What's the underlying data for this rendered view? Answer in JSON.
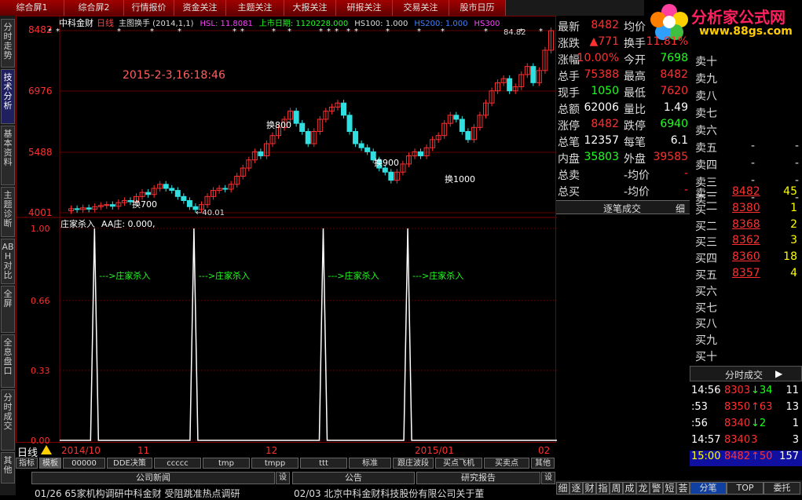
{
  "top_tabs": [
    "综合屏1",
    "综合屏2",
    "行情报价",
    "资金关注",
    "主题关注",
    "大报关注",
    "研报关注",
    "交易关注",
    "股市日历"
  ],
  "logo": {
    "text": "分析家公式网",
    "url": "www.88gs.com"
  },
  "side_tabs": [
    "分时走势",
    "技术分析",
    "基本资料",
    "主题诊断",
    "ABH对比",
    "全屏",
    "全息盘口",
    "分时成交",
    "其他"
  ],
  "chart": {
    "title": "中科金财",
    "period": "日线",
    "indicator_name": "主图换手 (2014,1,1)",
    "header_items": [
      "HSL: 11.8081",
      "上市日期: 1120228.000",
      "HS100: 1.000",
      "HS200: 1.000",
      "HS300"
    ],
    "datetime": "2015-2-3,16:18:46",
    "top_price": "84.82",
    "price_axis": [
      "8482",
      "6976",
      "5488",
      "4001"
    ],
    "low_label": "40.01",
    "annotations": [
      "换700",
      "换800",
      "换900",
      "换1000"
    ],
    "month_axis": [
      "2014/10",
      "11",
      "12",
      "2015/01",
      "02"
    ],
    "period_label": "日线"
  },
  "chart_data": {
    "type": "line",
    "title": "庄家杀入",
    "legend": "AA庄: 0.000,",
    "ylim": [
      0,
      1
    ],
    "y_ticks": [
      "1.00",
      "0.66",
      "0.33",
      "0.00"
    ],
    "spikes_label": "--->庄家杀入",
    "spike_positions_x_fraction": [
      0.07,
      0.27,
      0.53,
      0.7
    ],
    "series": [
      {
        "values": [
          0,
          1,
          0,
          1,
          0,
          1,
          0,
          1,
          0
        ]
      }
    ]
  },
  "indicator_tabs": [
    "指标",
    "模板",
    "00000",
    "DDE决策",
    "ccccc",
    "tmp",
    "tmpp",
    "ttt",
    "标准",
    "跟庄波段",
    "买点飞机",
    "买卖点",
    "其他"
  ],
  "news": {
    "company": "公司新闻",
    "notice": "公告",
    "report": "研究报告",
    "set": "设",
    "n1": "01/26 65家机构调研中科金财 受阻跳准热点调研",
    "n2": "02/03 北京中科金财科技股份有限公司关于董"
  },
  "quote": [
    [
      "最新",
      "8482",
      "均价",
      ""
    ],
    [
      "涨跌",
      "▲771",
      "换手",
      "11.81%"
    ],
    [
      "涨幅",
      "10.00%",
      "今开",
      "7698"
    ],
    [
      "总手",
      "75388",
      "最高",
      "8482"
    ],
    [
      "现手",
      "1050",
      "最低",
      "7620"
    ],
    [
      "总额",
      "62006",
      "量比",
      "1.49"
    ],
    [
      "涨停",
      "8482",
      "跌停",
      "6940"
    ],
    [
      "总笔",
      "12357",
      "每笔",
      "6.1"
    ],
    [
      "内盘",
      "35803",
      "外盘",
      "39585"
    ],
    [
      "总卖",
      "",
      "-均价",
      "-"
    ],
    [
      "总买",
      "",
      "-均价",
      "-"
    ]
  ],
  "zhubi": {
    "label": "逐笔成交",
    "btn": "细"
  },
  "sell": [
    [
      "卖十",
      "",
      ""
    ],
    [
      "卖九",
      "",
      ""
    ],
    [
      "卖八",
      "",
      ""
    ],
    [
      "卖七",
      "",
      ""
    ],
    [
      "卖六",
      "",
      ""
    ],
    [
      "卖五",
      "-",
      "-"
    ],
    [
      "卖四",
      "-",
      "-"
    ],
    [
      "卖三",
      "-",
      "-"
    ],
    [
      "卖二",
      "-",
      "-"
    ]
  ],
  "buy": [
    [
      "卖一",
      "8482",
      "45"
    ],
    [
      "买一",
      "8380",
      "1"
    ],
    [
      "买二",
      "8368",
      "2"
    ],
    [
      "买三",
      "8362",
      "3"
    ],
    [
      "买四",
      "8360",
      "18"
    ],
    [
      "买五",
      "8357",
      "4"
    ],
    [
      "买六",
      "",
      ""
    ],
    [
      "买七",
      "",
      ""
    ],
    [
      "买八",
      "",
      ""
    ],
    [
      "买九",
      "",
      ""
    ],
    [
      "买十",
      "",
      ""
    ]
  ],
  "ticks_title": "分时成交",
  "ticks": [
    [
      "14:56",
      "8303",
      "↓34",
      "11"
    ],
    [
      ":53",
      "8350",
      "↑63",
      "13"
    ],
    [
      ":56",
      "8340",
      "↓2",
      "1"
    ],
    [
      "14:57",
      "8340",
      "3",
      "3"
    ],
    [
      "15:00",
      "8482",
      "↑50",
      "157"
    ]
  ],
  "right_tabs": [
    "细",
    "逐",
    "财",
    "指",
    "周",
    "成",
    "龙",
    "警",
    "短",
    "荟"
  ],
  "bottom_right": [
    "分笔",
    "TOP",
    "委托"
  ]
}
